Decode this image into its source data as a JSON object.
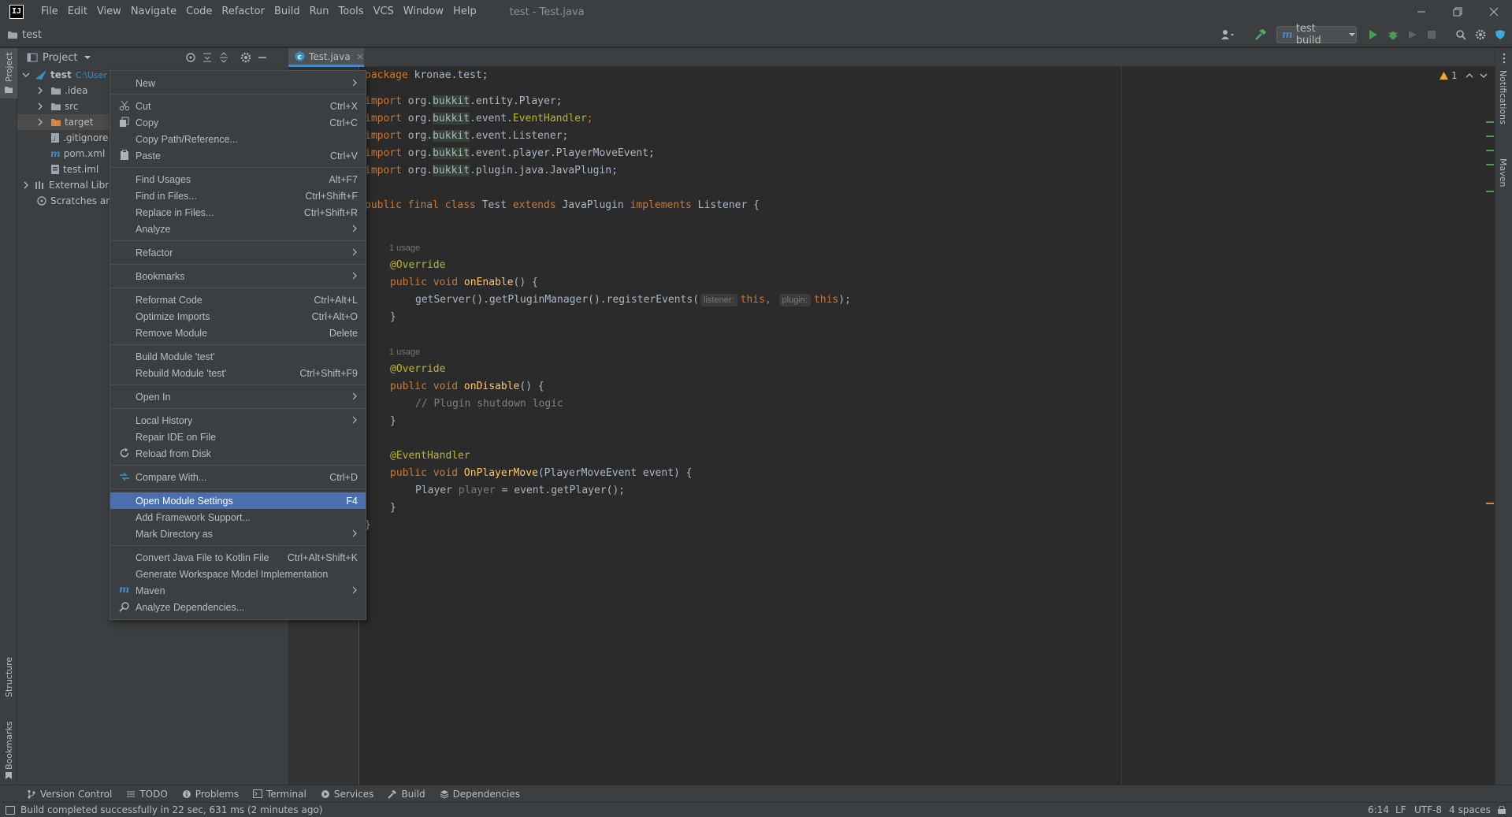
{
  "window": {
    "title": "test - Test.java",
    "logo_text": "IJ",
    "menus": [
      "File",
      "Edit",
      "View",
      "Navigate",
      "Code",
      "Refactor",
      "Build",
      "Run",
      "Tools",
      "VCS",
      "Window",
      "Help"
    ]
  },
  "navbar": {
    "path": "test",
    "run_config": "test build"
  },
  "left_strip": {
    "project": "Project",
    "structure": "Structure",
    "bookmarks": "Bookmarks"
  },
  "right_strip": {
    "notifications": "Notifications",
    "maven": "Maven"
  },
  "project_panel": {
    "title": "Project",
    "tree": [
      {
        "label": "test",
        "hint": "C:\\User"
      },
      {
        "label": ".idea"
      },
      {
        "label": "src"
      },
      {
        "label": "target"
      },
      {
        "label": ".gitignore"
      },
      {
        "label": "pom.xml"
      },
      {
        "label": "test.iml"
      },
      {
        "label": "External Librar"
      },
      {
        "label": "Scratches and"
      }
    ]
  },
  "editor": {
    "tab": "Test.java",
    "warning_count": "1",
    "usage1": "1 usage",
    "usage2": "1 usage",
    "hint_listener": "listener:",
    "hint_plugin": "plugin:",
    "lines": {
      "l1a": "package",
      "l1b": " kronae.test;",
      "i1": "import",
      "i1b": " org.",
      "i1c": "bukkit",
      "i1d": ".entity.Player;",
      "i2": "import",
      "i2b": " org.",
      "i2c": "bukkit",
      "i2d": ".event.",
      "i2e": "EventHandler",
      "i2f": ";",
      "i3": "import",
      "i3b": " org.",
      "i3c": "bukkit",
      "i3d": ".event.Listener;",
      "i4": "import",
      "i4b": " org.",
      "i4c": "bukkit",
      "i4d": ".event.player.PlayerMoveEvent;",
      "i5": "import",
      "i5b": " org.",
      "i5c": "bukkit",
      "i5d": ".plugin.java.JavaPlugin;",
      "c1": "public final class",
      "c2": " Test ",
      "c3": "extends",
      "c4": " JavaPlugin ",
      "c5": "implements",
      "c6": " Listener {",
      "o1": "@Override",
      "e1": "public void ",
      "e2": "onEnable",
      "e3": "() {",
      "g1": "getServer().getPluginManager().registerEvents(",
      "g2": "this",
      "g3": ",",
      "g4": "this",
      "g5": ");",
      "close1": "}",
      "o2": "@Override",
      "d1": "public void ",
      "d2": "onDisable",
      "d3": "() {",
      "cm": "// Plugin shutdown logic",
      "close2": "}",
      "eh": "@EventHandler",
      "p1": "public void ",
      "p2": "OnPlayerMove",
      "p3": "(PlayerMoveEvent event) {",
      "pl1": "Player ",
      "pl2": "player",
      "pl3": " = event.getPlayer();",
      "close3": "}",
      "close4": "}"
    }
  },
  "context_menu": {
    "items": [
      {
        "label": "New",
        "submenu": true
      },
      {
        "label": "Cut",
        "shortcut": "Ctrl+X",
        "icon": "scissors-icon"
      },
      {
        "label": "Copy",
        "shortcut": "Ctrl+C",
        "icon": "copy-icon"
      },
      {
        "label": "Copy Path/Reference..."
      },
      {
        "label": "Paste",
        "shortcut": "Ctrl+V",
        "icon": "paste-icon"
      },
      {
        "label": "Find Usages",
        "shortcut": "Alt+F7"
      },
      {
        "label": "Find in Files...",
        "shortcut": "Ctrl+Shift+F"
      },
      {
        "label": "Replace in Files...",
        "shortcut": "Ctrl+Shift+R"
      },
      {
        "label": "Analyze",
        "submenu": true
      },
      {
        "label": "Refactor",
        "submenu": true
      },
      {
        "label": "Bookmarks",
        "submenu": true
      },
      {
        "label": "Reformat Code",
        "shortcut": "Ctrl+Alt+L"
      },
      {
        "label": "Optimize Imports",
        "shortcut": "Ctrl+Alt+O"
      },
      {
        "label": "Remove Module",
        "shortcut": "Delete"
      },
      {
        "label": "Build Module 'test'"
      },
      {
        "label": "Rebuild Module 'test'",
        "shortcut": "Ctrl+Shift+F9"
      },
      {
        "label": "Open In",
        "submenu": true
      },
      {
        "label": "Local History",
        "submenu": true
      },
      {
        "label": "Repair IDE on File"
      },
      {
        "label": "Reload from Disk",
        "icon": "reload-icon"
      },
      {
        "label": "Compare With...",
        "shortcut": "Ctrl+D",
        "icon": "compare-icon"
      },
      {
        "label": "Open Module Settings",
        "shortcut": "F4",
        "selected": true
      },
      {
        "label": "Add Framework Support..."
      },
      {
        "label": "Mark Directory as",
        "submenu": true
      },
      {
        "label": "Convert Java File to Kotlin File",
        "shortcut": "Ctrl+Alt+Shift+K"
      },
      {
        "label": "Generate Workspace Model Implementation"
      },
      {
        "label": "Maven",
        "submenu": true,
        "icon": "maven-icon"
      },
      {
        "label": "Analyze Dependencies...",
        "icon": "analyze-icon"
      }
    ]
  },
  "bottom_tabs": [
    "Version Control",
    "TODO",
    "Problems",
    "Terminal",
    "Services",
    "Build",
    "Dependencies"
  ],
  "status": {
    "message": "Build completed successfully in 22 sec, 631 ms (2 minutes ago)",
    "position": "6:14",
    "line_sep": "LF",
    "encoding": "UTF-8",
    "indent": "4 spaces"
  },
  "colors": {
    "background": "#2b2b2b",
    "panel": "#3c3f41",
    "selection": "#4b6eaf",
    "keyword": "#cc7832",
    "annotation": "#bbb529",
    "function": "#ffc66d"
  }
}
